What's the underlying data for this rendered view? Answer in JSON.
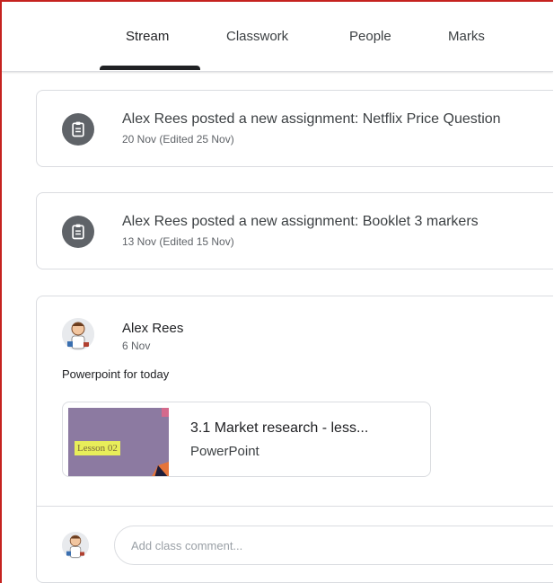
{
  "tabs": [
    {
      "label": "Stream"
    },
    {
      "label": "Classwork"
    },
    {
      "label": "People"
    },
    {
      "label": "Marks"
    }
  ],
  "stream": {
    "assignments": [
      {
        "title": "Alex Rees posted a new assignment: Netflix Price Question",
        "date": "20 Nov (Edited 25 Nov)",
        "icon": "assignment-icon"
      },
      {
        "title": "Alex Rees posted a new assignment: Booklet 3 markers",
        "date": "13 Nov (Edited 15 Nov)",
        "icon": "assignment-icon"
      }
    ],
    "post": {
      "author": "Alex Rees",
      "date": "6 Nov",
      "text": "Powerpoint for today",
      "attachment": {
        "title": "3.1 Market research - less...",
        "type": "PowerPoint",
        "thumbnail_label": "Lesson 02"
      },
      "comment_placeholder": "Add class comment..."
    }
  },
  "colors": {
    "window_border": "#c5221f",
    "icon_bg": "#5f6368",
    "thumbnail_bg": "#8c7aa1"
  }
}
